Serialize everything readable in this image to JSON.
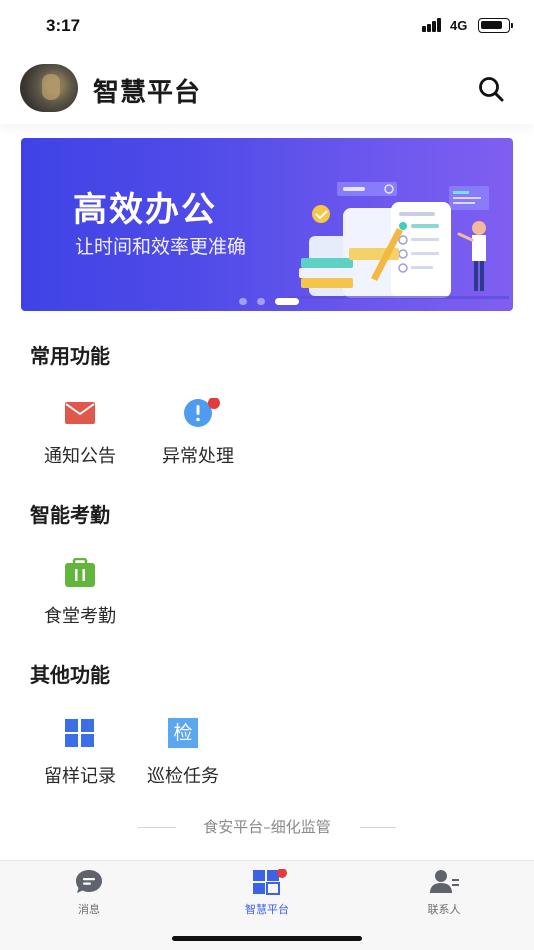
{
  "status_bar": {
    "time": "3:17",
    "network": "4G",
    "battery_level": 0.85
  },
  "header": {
    "title": "智慧平台",
    "avatar_icon": "avatar-photo",
    "search_icon": "search-icon"
  },
  "banner": {
    "title": "高效办公",
    "subtitle": "让时间和效率更准确",
    "slide_count": 3,
    "active_slide": 3,
    "gradient_colors": [
      "#3f43e6",
      "#7f5ff0"
    ]
  },
  "sections": [
    {
      "title": "常用功能",
      "items": [
        {
          "label": "通知公告",
          "icon": "mail-icon",
          "color": "#e0584b",
          "badge": false
        },
        {
          "label": "异常处理",
          "icon": "alert-icon",
          "color": "#4d9cf0",
          "badge": true
        }
      ]
    },
    {
      "title": "智能考勤",
      "items": [
        {
          "label": "食堂考勤",
          "icon": "briefcase-icon",
          "color": "#63b63c",
          "badge": false
        }
      ]
    },
    {
      "title": "其他功能",
      "items": [
        {
          "label": "留样记录",
          "icon": "grid-icon",
          "color": "#3c6ee6",
          "badge": false
        },
        {
          "label": "巡检任务",
          "icon": "inspection-icon",
          "icon_text": "检",
          "color": "#5aa6ef",
          "badge": false
        }
      ]
    }
  ],
  "footer": {
    "slogan": "食安平台–细化监管"
  },
  "tab_bar": {
    "tabs": [
      {
        "label": "消息",
        "icon": "message-icon",
        "active": false,
        "badge": false
      },
      {
        "label": "智慧平台",
        "icon": "grid-icon",
        "active": true,
        "badge": true
      },
      {
        "label": "联系人",
        "icon": "contacts-icon",
        "active": false,
        "badge": false
      }
    ],
    "active_color": "#3b63e8",
    "inactive_color": "#6f6f6f"
  }
}
